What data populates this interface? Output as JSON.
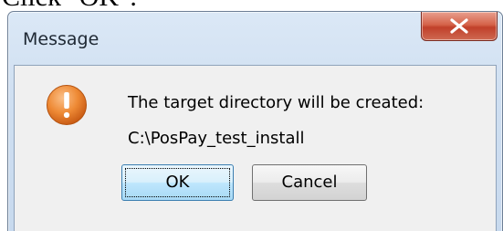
{
  "instruction": {
    "text": "Click \"OK\"."
  },
  "dialog": {
    "title": "Message",
    "icon": "warning-icon",
    "message_line_1": "The target directory will be created:",
    "message_line_2": "C:\\PosPay_test_install",
    "buttons": {
      "ok_label": "OK",
      "cancel_label": "Cancel"
    },
    "colors": {
      "warning_orange": "#e8792b",
      "close_red": "#c7432c"
    }
  }
}
